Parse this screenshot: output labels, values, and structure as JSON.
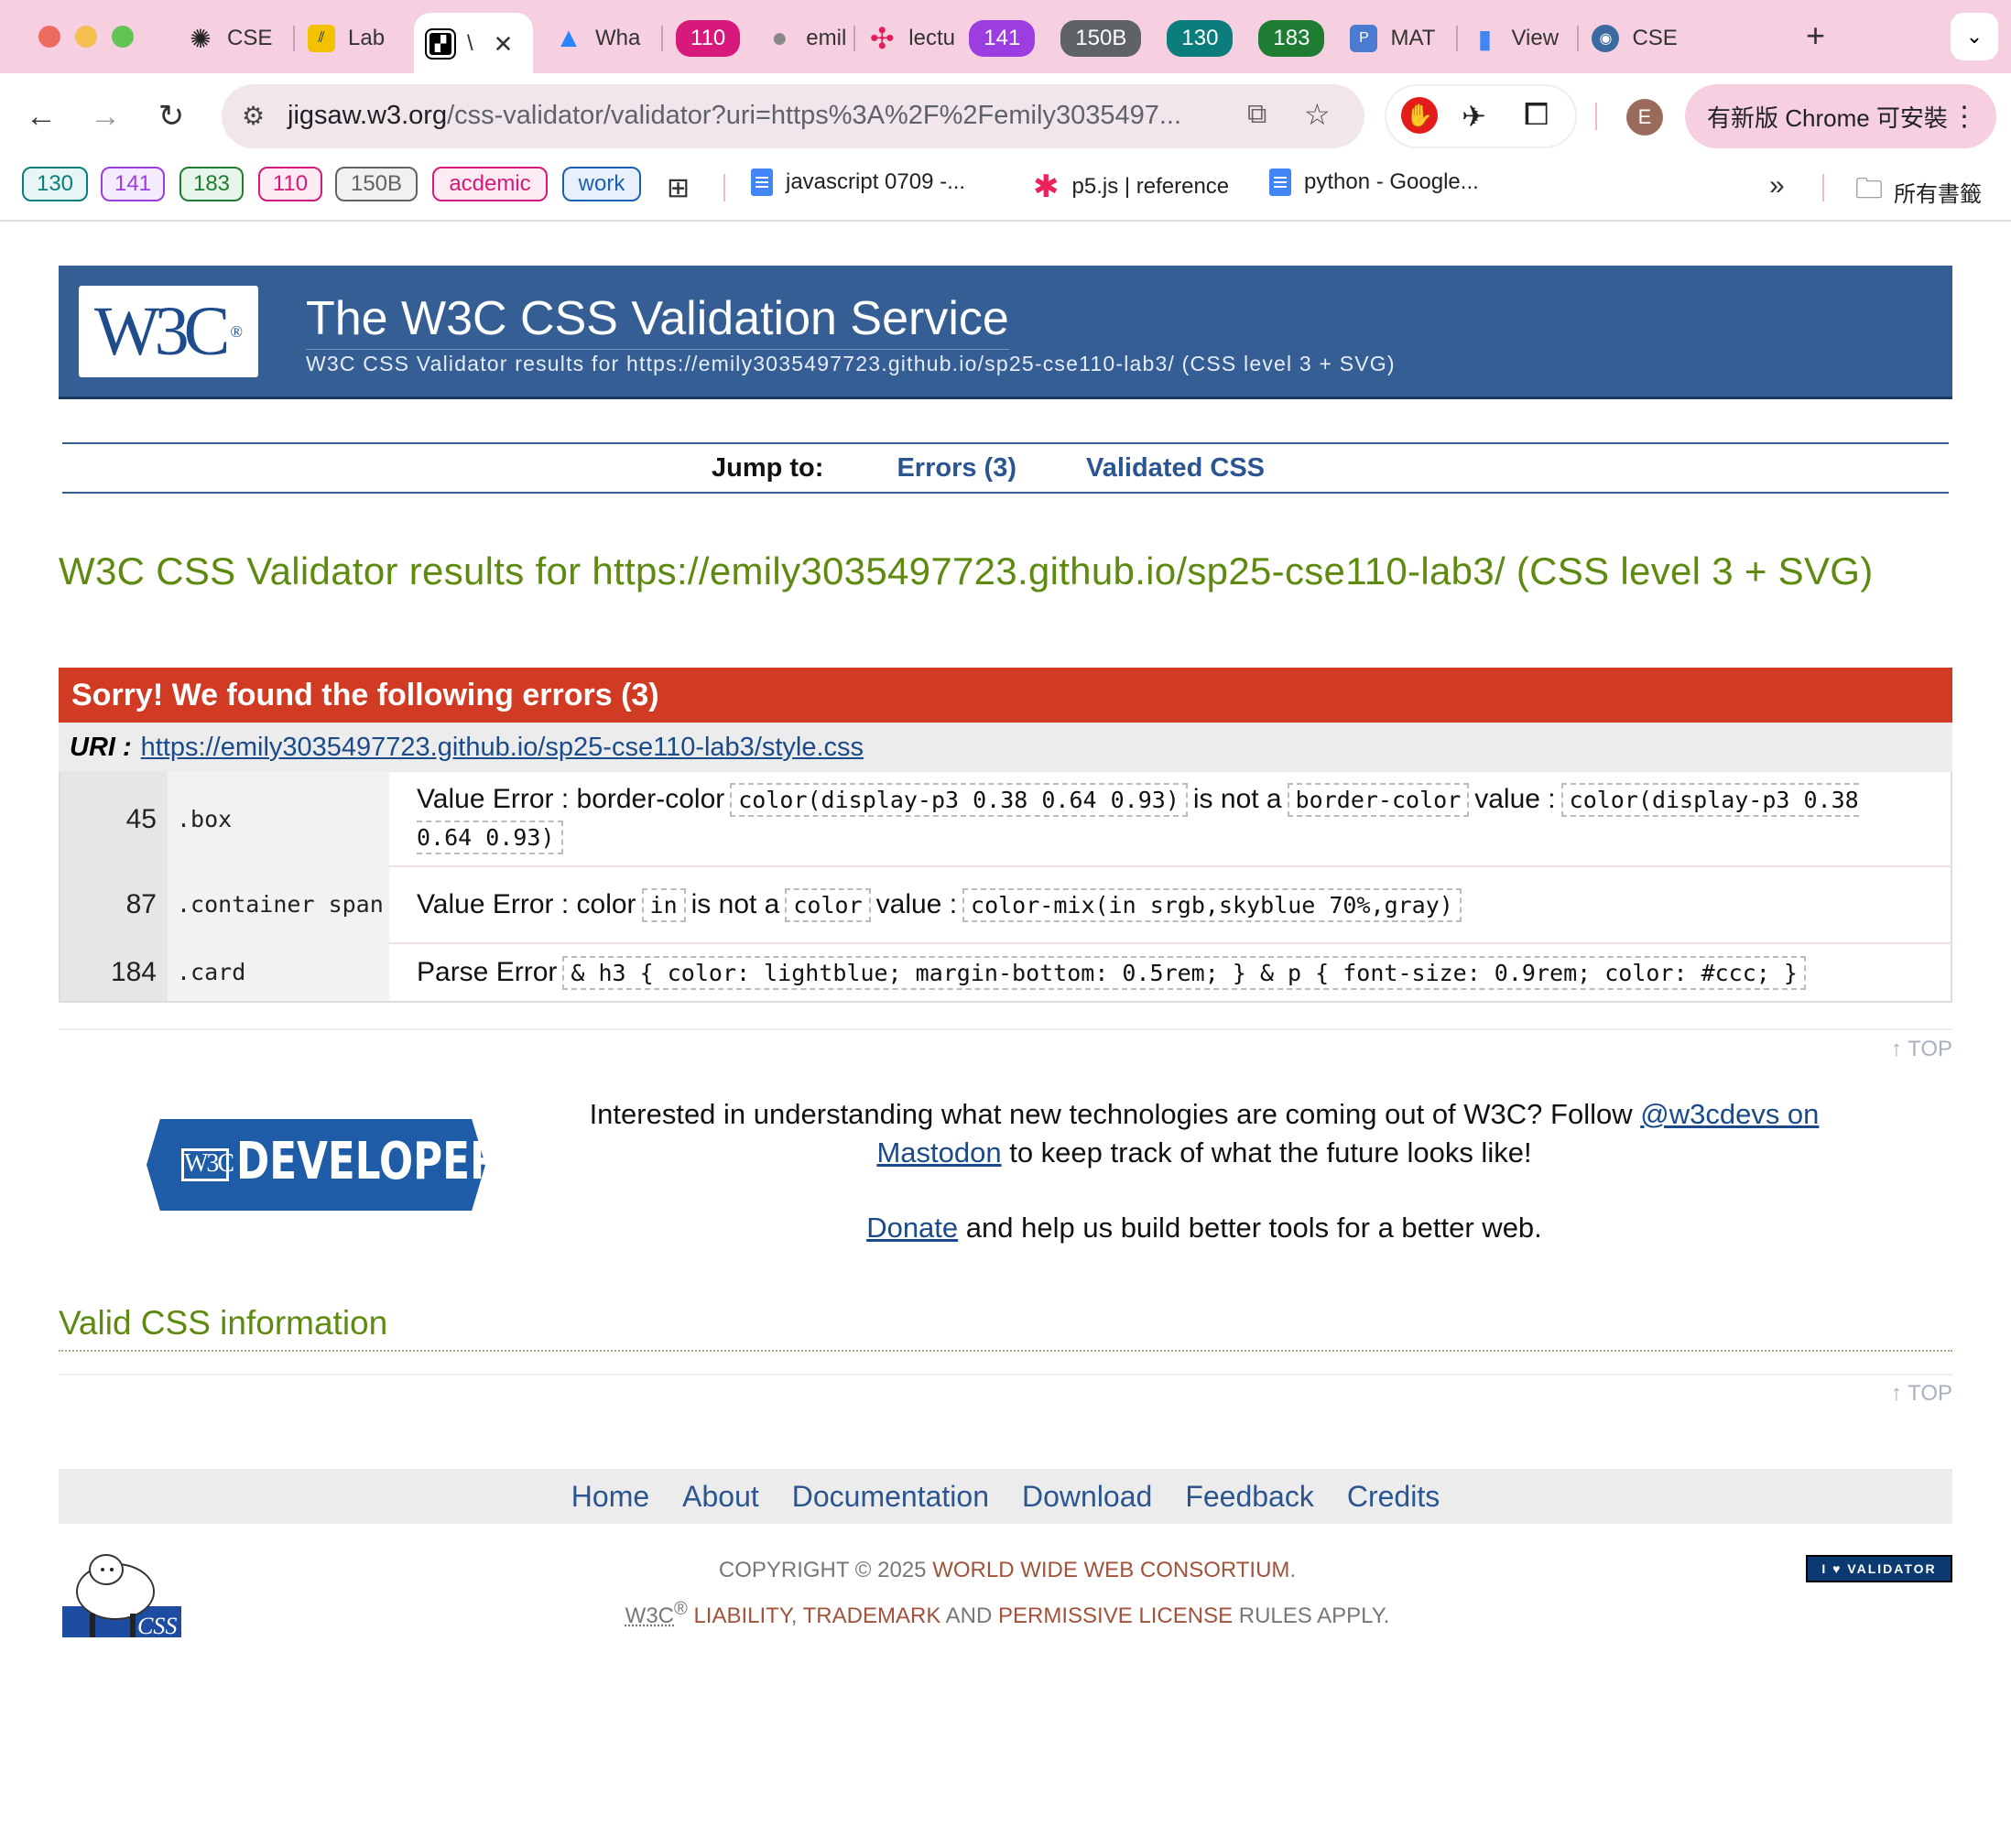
{
  "browser": {
    "tabs": [
      {
        "label": "CSE",
        "icon": "openai-icon",
        "color": "#222222"
      },
      {
        "label": "Lab",
        "icon": "lab-icon",
        "color": "#f2c200"
      },
      {
        "label": "\\",
        "icon": "validator-icon",
        "color": "#000000",
        "active": true
      },
      {
        "label": "Wha",
        "icon": "atlassian-icon",
        "color": "#2684ff"
      },
      {
        "label": "110",
        "pill": true,
        "color": "#d6197a"
      },
      {
        "label": "emil",
        "icon": "github-icon",
        "color": "#999999"
      },
      {
        "label": "lectu",
        "icon": "slack-icon",
        "color": "#e01e5a"
      },
      {
        "label": "141",
        "pill": true,
        "color": "#9b3de0"
      },
      {
        "label": "150B",
        "pill": true,
        "color": "#5f6368"
      },
      {
        "label": "130",
        "pill": true,
        "color": "#0b7d7d"
      },
      {
        "label": "183",
        "pill": true,
        "color": "#1e7d33"
      },
      {
        "label": "MAT",
        "icon": "p-icon",
        "color": "#4a7bd0"
      },
      {
        "label": "View",
        "icon": "bars-icon",
        "color": "#4285f4"
      },
      {
        "label": "CSE",
        "icon": "globe-icon",
        "color": "#3b6aa0"
      }
    ],
    "url_host": "jigsaw.w3.org",
    "url_path": "/css-validator/validator?uri=https%3A%2F%2Femily3035497...",
    "profile_initial": "E",
    "update_label": "有新版 Chrome 可安裝",
    "bookmarks": [
      {
        "label": "130",
        "color": "#0b7d7d"
      },
      {
        "label": "141",
        "color": "#9b3de0"
      },
      {
        "label": "183",
        "color": "#1e7d33"
      },
      {
        "label": "110",
        "color": "#d6197a"
      },
      {
        "label": "150B",
        "color": "#5f6368"
      },
      {
        "label": "acdemic",
        "color": "#d6197a"
      },
      {
        "label": "work",
        "color": "#1a5fb4"
      }
    ],
    "bookmark_links": [
      "javascript 0709 -...",
      "p5.js | reference",
      "python - Google..."
    ],
    "all_bookmarks": "所有書籤"
  },
  "banner": {
    "logo": "W3C",
    "title": "The W3C CSS Validation Service",
    "subtitle": "W3C CSS Validator results for https://emily3035497723.github.io/sp25-cse110-lab3/ (CSS level 3 + SVG)"
  },
  "jump": {
    "label": "Jump to:",
    "errors": "Errors (3)",
    "validated": "Validated CSS"
  },
  "results_title": "W3C CSS Validator results for https://emily3035497723.github.io/sp25-cse110-lab3/ (CSS level 3 + SVG)",
  "errors": {
    "heading": "Sorry! We found the following errors (3)",
    "uri_label": "URI :",
    "uri": "https://emily3035497723.github.io/sp25-cse110-lab3/style.css",
    "rows": [
      {
        "line": "45",
        "context": ".box",
        "type": "Value Error : border-color",
        "code1": "color(display-p3 0.38 0.64 0.93)",
        "mid": "is not a",
        "code2": "border-color",
        "tail": "value :",
        "code3": "color(display-p3 0.38 0.64 0.93)"
      },
      {
        "line": "87",
        "context": ".container span",
        "type": "Value Error : color",
        "code1": "in",
        "mid": "is not a",
        "code2": "color",
        "tail": "value :",
        "code3": "color-mix(in srgb,skyblue 70%,gray)"
      },
      {
        "line": "184",
        "context": ".card",
        "type": "Parse Error",
        "code1": "& h3 { color: lightblue; margin-bottom: 0.5rem; } & p { font-size: 0.9rem; color: #ccc; }"
      }
    ]
  },
  "top_label": "↑ TOP",
  "developers": {
    "logo_mark": "W3C",
    "logo_text": "DEVELOPERS",
    "line1": "Interested in understanding what new technologies are coming out of W3C? Follow",
    "link1": "@w3cdevs on Mastodon",
    "line1b": "to keep track of what the future looks like!",
    "donate": "Donate",
    "line2": "and help us build better tools for a better web."
  },
  "valid_title": "Valid CSS information",
  "footer": {
    "links": [
      "Home",
      "About",
      "Documentation",
      "Download",
      "Feedback",
      "Credits"
    ],
    "copyright_prefix": "COPYRIGHT © 2025",
    "consortium": "WORLD WIDE WEB CONSORTIUM",
    "w3c": "W3C",
    "reg": "®",
    "liability": "LIABILITY",
    "trademark": "TRADEMARK",
    "and": "AND",
    "license": "PERMISSIVE LICENSE",
    "rules": "RULES APPLY.",
    "badge": "I ♥ VALIDATOR",
    "sheep_label": "CSS"
  }
}
